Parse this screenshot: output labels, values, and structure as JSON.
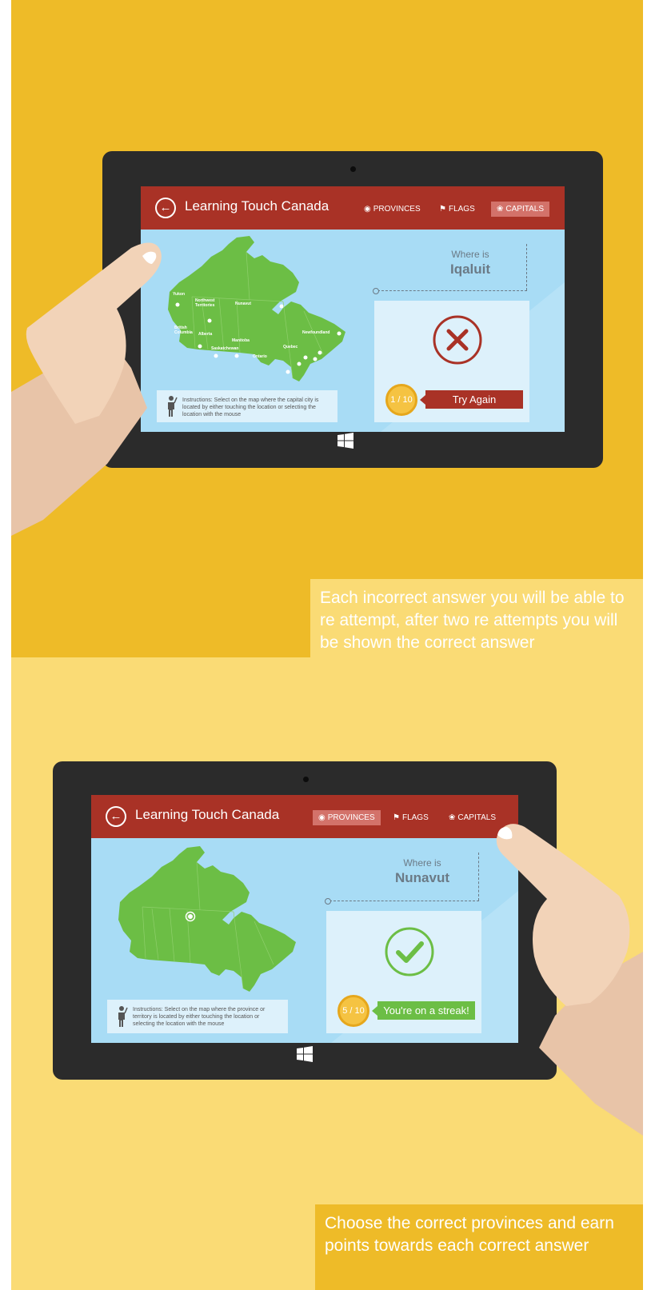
{
  "colors": {
    "orange_bg": "#EEBB28",
    "light_yellow_bg": "#FADB75",
    "appbar_red": "#A93226",
    "map_green": "#6CBE45",
    "screen_blue": "#A8DCF5",
    "error_red": "#A93226",
    "success_green": "#6CBE45"
  },
  "icons": {
    "back": "back-arrow-circle-icon",
    "provinces": "radio-target-icon",
    "flags": "flag-icon",
    "capitals": "maple-leaf-icon",
    "windows": "windows-logo-icon",
    "instructions": "person-pointing-icon",
    "wrong": "x-circle-icon",
    "correct": "checkmark-circle-icon"
  },
  "screen1": {
    "app_title": "Learning Touch Canada",
    "nav": {
      "provinces": "PROVINCES",
      "flags": "FLAGS",
      "capitals": "CAPITALS",
      "active": "capitals"
    },
    "question": {
      "prompt": "Where is",
      "place": "Iqaluit"
    },
    "score": "1 / 10",
    "result_button": "Try Again",
    "instructions": "Instructions: Select on the map where the capital city is located by either touching the location or selecting the location with the mouse",
    "map_labels": {
      "yukon": "Yukon",
      "nwt1": "Northwest",
      "nwt2": "Territories",
      "nunavut": "Nunavut",
      "bc1": "British",
      "bc2": "Columbia",
      "alberta": "Alberta",
      "saskatchewan": "Saskatchewan",
      "manitoba": "Manitoba",
      "ontario": "Ontario",
      "quebec": "Quebec",
      "newfoundland": "Newfoundland"
    }
  },
  "caption1": "Each incorrect answer you will be able to re attempt, after two re attempts you will be shown the correct answer",
  "screen2": {
    "app_title": "Learning Touch Canada",
    "nav": {
      "provinces": "PROVINCES",
      "flags": "FLAGS",
      "capitals": "CAPITALS",
      "active": "provinces"
    },
    "question": {
      "prompt": "Where is",
      "place": "Nunavut"
    },
    "score": "5 / 10",
    "result_button": "You're on a streak!",
    "instructions": "Instructions: Select on the map where the province or territory is located by either touching the location or selecting the location with the mouse"
  },
  "caption2": "Choose the correct provinces and earn points towards each correct answer"
}
